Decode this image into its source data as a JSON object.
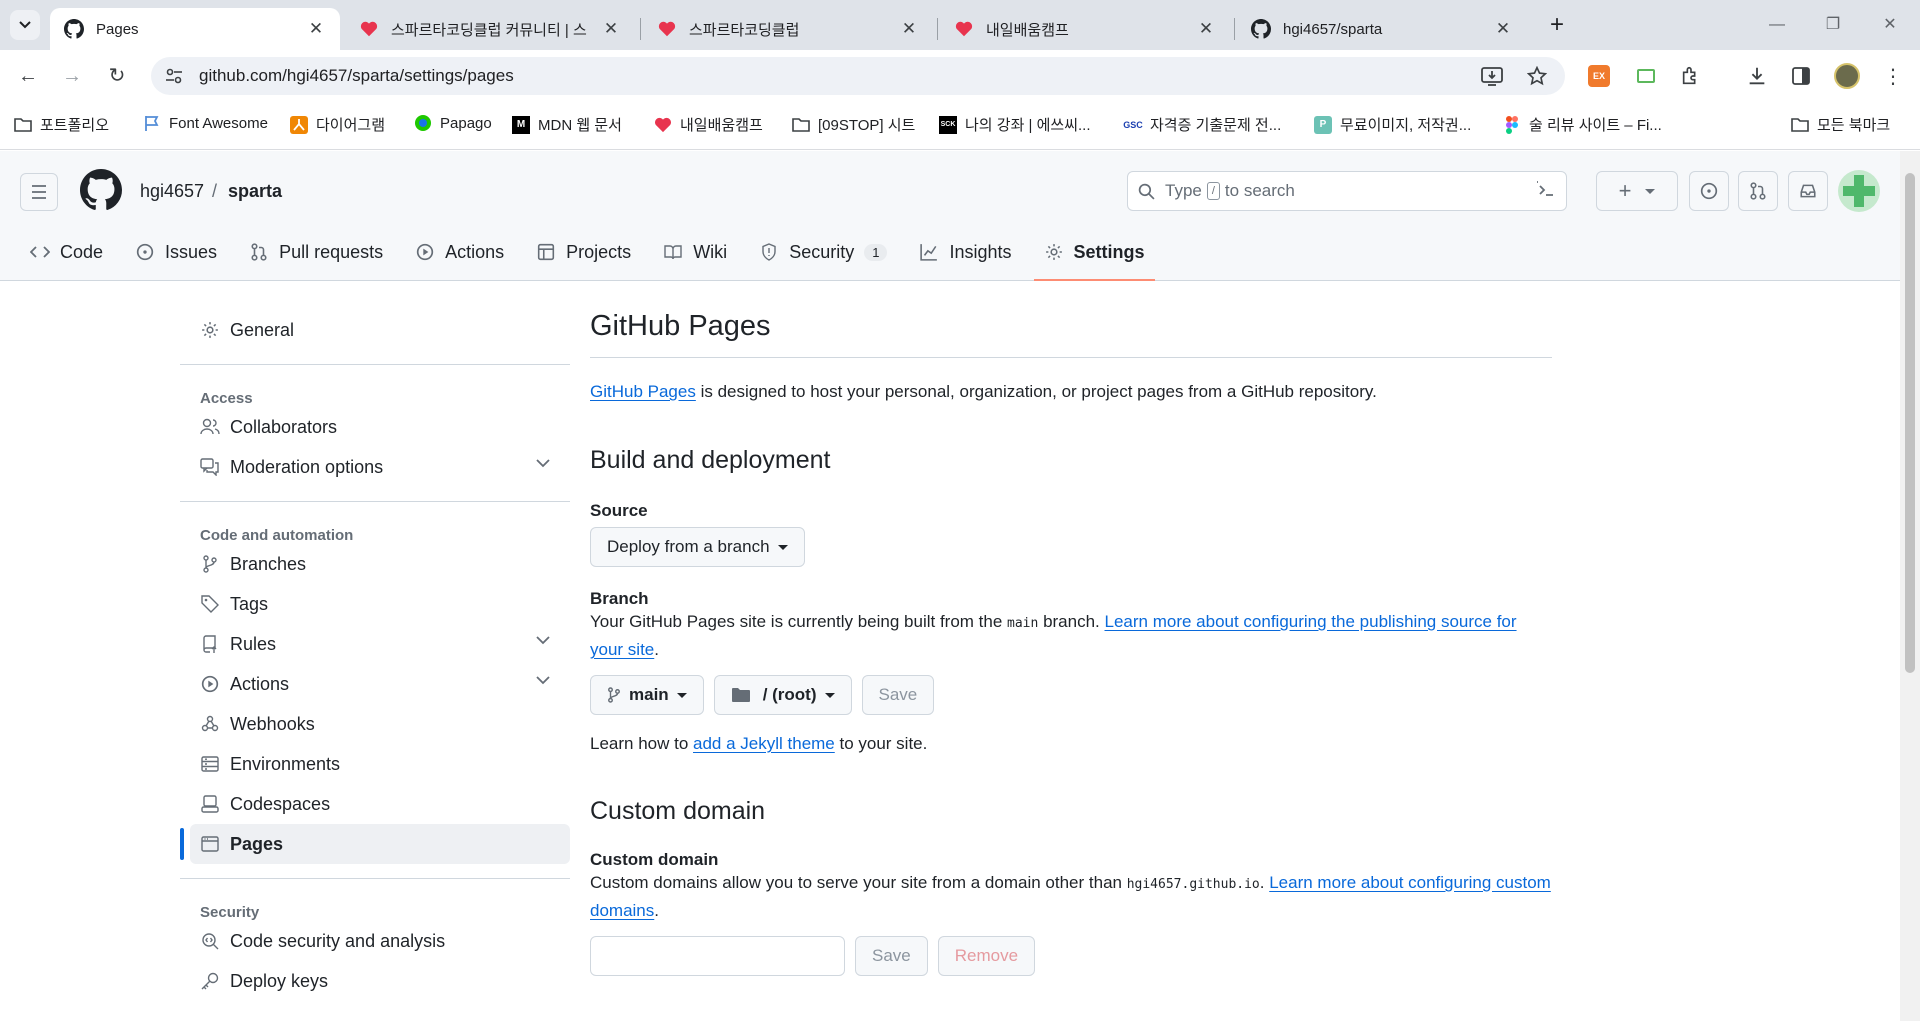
{
  "browser": {
    "tabs": [
      {
        "title": "Pages",
        "icon": "github-icon"
      },
      {
        "title": "스파르타코딩클럽 커뮤니티 | 스",
        "icon": "sparta-heart-icon"
      },
      {
        "title": "스파르타코딩클럽",
        "icon": "sparta-heart-icon"
      },
      {
        "title": "내일배움캠프",
        "icon": "sparta-heart-icon"
      },
      {
        "title": "hgi4657/sparta",
        "icon": "github-icon"
      }
    ],
    "url": "github.com/hgi4657/sparta/settings/pages",
    "bookmarks": [
      "포트폴리오",
      "Font Awesome",
      "다이어그램",
      "Papago",
      "MDN 웹 문서",
      "내일배움캠프",
      "[09STOP] 시트",
      "나의 강좌 | 에쓰씨...",
      "자격증 기출문제 전...",
      "무료이미지, 저작권...",
      "술 리뷰 사이트 – Fi..."
    ],
    "bookmarks_right": "모든 북마크",
    "ext_label": "EX"
  },
  "github": {
    "owner": "hgi4657",
    "separator": "/",
    "repo": "sparta",
    "search_prefix": "Type",
    "search_key": "/",
    "search_suffix": "to search",
    "plus": "+",
    "repo_nav": [
      {
        "label": "Code",
        "icon": "code-icon"
      },
      {
        "label": "Issues",
        "icon": "issue-icon"
      },
      {
        "label": "Pull requests",
        "icon": "pull-request-icon"
      },
      {
        "label": "Actions",
        "icon": "actions-play-icon"
      },
      {
        "label": "Projects",
        "icon": "table-icon"
      },
      {
        "label": "Wiki",
        "icon": "book-icon"
      },
      {
        "label": "Security",
        "icon": "shield-icon",
        "count": "1"
      },
      {
        "label": "Insights",
        "icon": "graph-icon"
      },
      {
        "label": "Settings",
        "icon": "gear-icon"
      }
    ]
  },
  "sidebar": {
    "general": "General",
    "access_heading": "Access",
    "access": [
      "Collaborators",
      "Moderation options"
    ],
    "code_heading": "Code and automation",
    "code": [
      "Branches",
      "Tags",
      "Rules",
      "Actions",
      "Webhooks",
      "Environments",
      "Codespaces",
      "Pages"
    ],
    "security_heading": "Security",
    "security": [
      "Code security and analysis",
      "Deploy keys"
    ]
  },
  "main": {
    "title": "GitHub Pages",
    "lead_link": "GitHub Pages",
    "lead_text": " is designed to host your personal, organization, or project pages from a GitHub repository.",
    "build_title": "Build and deployment",
    "source_label": "Source",
    "source_value": "Deploy from a branch",
    "branch_label": "Branch",
    "branch_text_1": "Your GitHub Pages site is currently being built from the ",
    "branch_code": "main",
    "branch_text_2": " branch. ",
    "branch_link": "Learn more about configuring the publishing source for your site",
    "branch_end": ".",
    "branch_select": "main",
    "folder_select": "/ (root)",
    "save": "Save",
    "jekyll_pre": "Learn how to ",
    "jekyll_link": "add a Jekyll theme",
    "jekyll_post": " to your site.",
    "custom_title": "Custom domain",
    "custom_label": "Custom domain",
    "custom_text": "Custom domains allow you to serve your site from a domain other than ",
    "custom_code": "hgi4657.github.io",
    "custom_text_2": ". ",
    "custom_link": "Learn more about configuring custom domains",
    "custom_end": ".",
    "custom_save": "Save",
    "custom_remove": "Remove"
  }
}
